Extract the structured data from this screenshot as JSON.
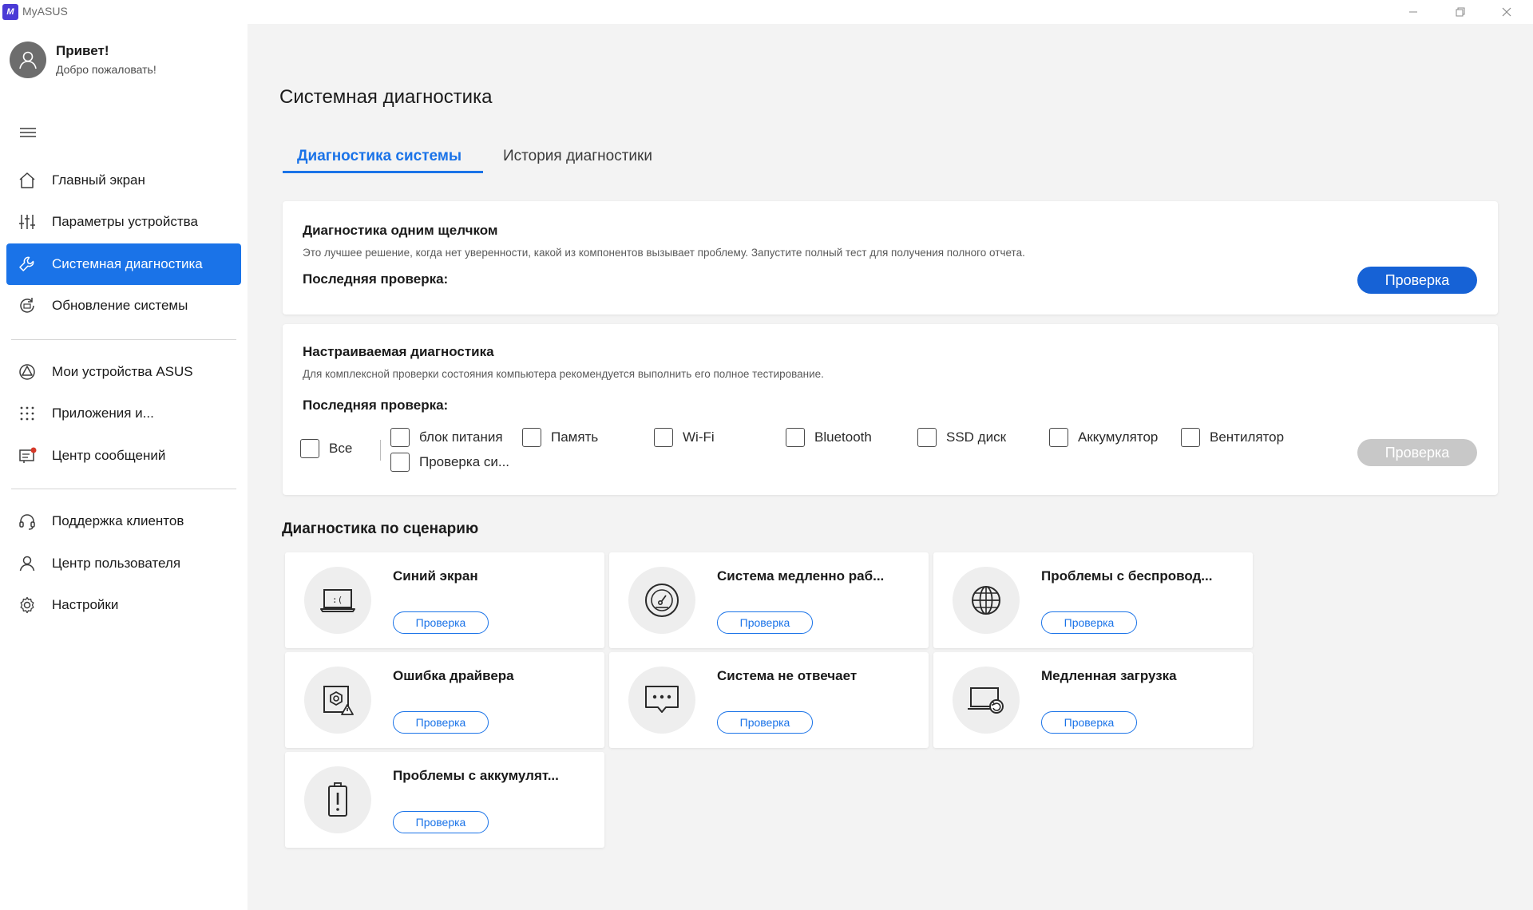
{
  "window": {
    "logo_text": "M",
    "title": "MyASUS"
  },
  "profile": {
    "greeting": "Привет!",
    "welcome": "Добро пожаловать!"
  },
  "sidebar": {
    "items": [
      {
        "label": "Главный экран",
        "icon": "home-icon"
      },
      {
        "label": "Параметры устройства",
        "icon": "sliders-icon"
      },
      {
        "label": "Системная диагностика",
        "icon": "wrench-icon",
        "active": true
      },
      {
        "label": "Обновление системы",
        "icon": "update-icon"
      },
      {
        "label": "Мои устройства ASUS",
        "icon": "devices-icon"
      },
      {
        "label": "Приложения и...",
        "icon": "apps-grid-icon"
      },
      {
        "label": "Центр сообщений",
        "icon": "message-center-icon"
      },
      {
        "label": "Поддержка клиентов",
        "icon": "headset-icon"
      },
      {
        "label": "Центр пользователя",
        "icon": "user-icon"
      },
      {
        "label": "Настройки",
        "icon": "gear-icon"
      }
    ]
  },
  "main": {
    "title": "Системная диагностика",
    "tabs": [
      {
        "label": "Диагностика системы",
        "active": true
      },
      {
        "label": "История диагностики",
        "active": false
      }
    ],
    "one_click": {
      "title": "Диагностика одним щелчком",
      "description": "Это лучшее решение, когда нет уверенности, какой из компонентов вызывает проблему. Запустите полный тест для получения полного отчета.",
      "last_check": "Последняя проверка:",
      "button": "Проверка"
    },
    "custom": {
      "title": "Настраиваемая диагностика",
      "description": "Для комплексной проверки состояния компьютера рекомендуется выполнить его полное тестирование.",
      "last_check": "Последняя проверка:",
      "all_label": "Все",
      "options": [
        "блок питания",
        "Память",
        "Wi-Fi",
        "Bluetooth",
        "SSD диск",
        "Аккумулятор",
        "Вентилятор",
        "Проверка си..."
      ],
      "button": "Проверка"
    },
    "scenario": {
      "title": "Диагностика по сценарию",
      "button_label": "Проверка",
      "items": [
        {
          "title": "Синий экран",
          "icon": "blue-screen-laptop-icon"
        },
        {
          "title": "Система медленно раб...",
          "icon": "speedometer-icon"
        },
        {
          "title": "Проблемы с беспровод...",
          "icon": "globe-icon"
        },
        {
          "title": "Ошибка драйвера",
          "icon": "driver-error-icon"
        },
        {
          "title": "Система не отвечает",
          "icon": "chat-dots-icon"
        },
        {
          "title": "Медленная загрузка",
          "icon": "slow-boot-icon"
        },
        {
          "title": "Проблемы с аккумулят...",
          "icon": "battery-alert-icon"
        }
      ]
    }
  },
  "colors": {
    "accent": "#1a73e8",
    "primary_button": "#1662d6",
    "disabled_button": "#c8c8c8",
    "notification_dot": "#d63a2a"
  }
}
